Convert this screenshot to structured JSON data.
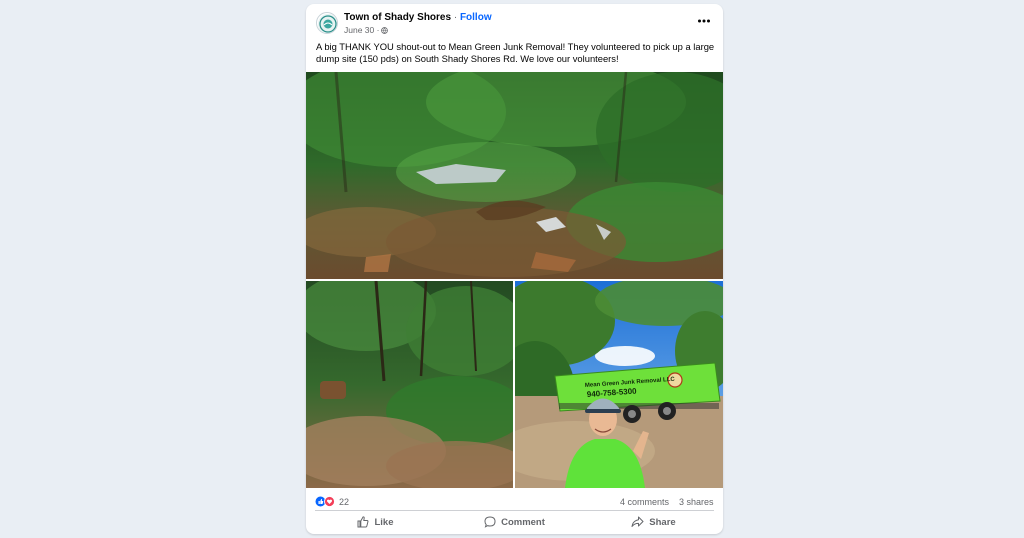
{
  "post": {
    "page_name": "Town of Shady Shores",
    "separator": " · ",
    "follow_label": "Follow",
    "date": "June 30 ·",
    "audience_icon": "globe-icon",
    "more_icon": "more-options-icon",
    "caption": "A big THANK YOU shout-out to Mean Green Junk Removal! They volunteered to pick up a large dump site (150 pds) on South Shady Shores Rd. We love our volunteers!",
    "photos": {
      "truck_company_text": "Mean Green Junk Removal LLC",
      "truck_phone_text": "940-758-5300"
    }
  },
  "stats": {
    "reaction_icons": [
      "like-icon",
      "love-icon"
    ],
    "reaction_count": "22",
    "comments": "4 comments",
    "shares": "3 shares"
  },
  "actions": {
    "like_label": "Like",
    "comment_label": "Comment",
    "share_label": "Share"
  },
  "colors": {
    "background": "#e9eef4",
    "follow_link": "#0866ff",
    "secondary_text": "#65676b",
    "truck_green": "#6ee03a"
  }
}
